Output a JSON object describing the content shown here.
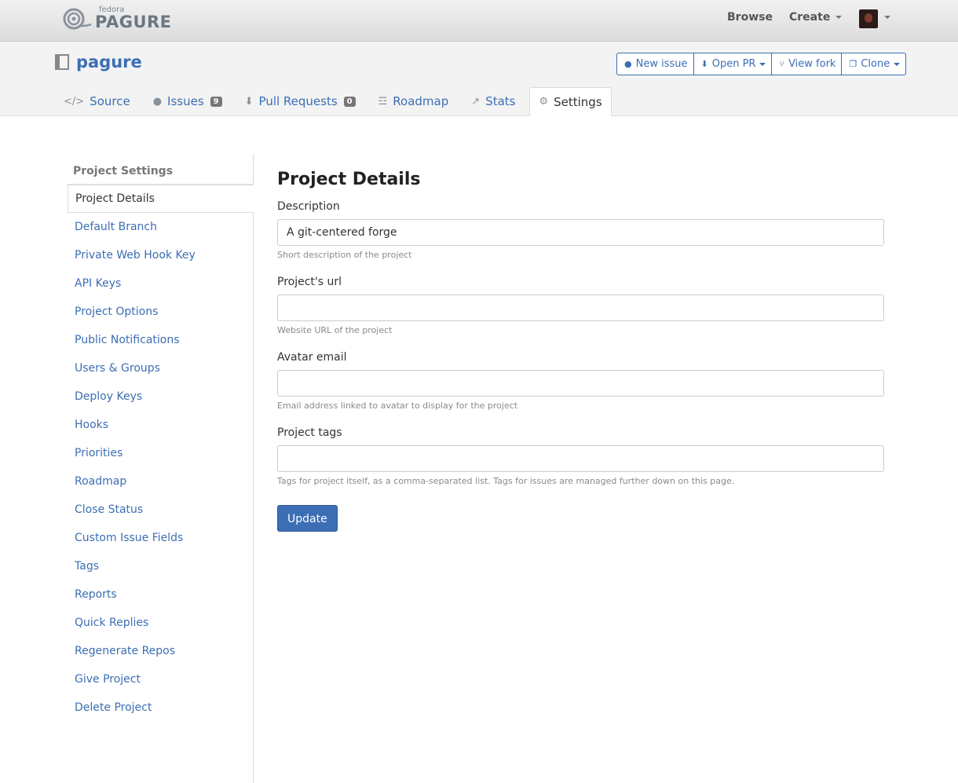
{
  "topnav": {
    "logo_small": "fedora",
    "logo_big": "PAGURE",
    "browse": "Browse",
    "create": "Create"
  },
  "project": {
    "name": "pagure",
    "actions": {
      "new_issue": "New issue",
      "open_pr": "Open PR",
      "view_fork": "View fork",
      "clone": "Clone"
    },
    "tabs": [
      {
        "label": "Source",
        "icon": "code-icon"
      },
      {
        "label": "Issues",
        "icon": "exclamation-icon",
        "badge": "9"
      },
      {
        "label": "Pull Requests",
        "icon": "pull-request-icon",
        "badge": "0"
      },
      {
        "label": "Roadmap",
        "icon": "signpost-icon"
      },
      {
        "label": "Stats",
        "icon": "chart-icon"
      },
      {
        "label": "Settings",
        "icon": "gears-icon"
      }
    ]
  },
  "sidebar": {
    "heading": "Project Settings",
    "items": [
      "Project Details",
      "Default Branch",
      "Private Web Hook Key",
      "API Keys",
      "Project Options",
      "Public Notifications",
      "Users & Groups",
      "Deploy Keys",
      "Hooks",
      "Priorities",
      "Roadmap",
      "Close Status",
      "Custom Issue Fields",
      "Tags",
      "Reports",
      "Quick Replies",
      "Regenerate Repos",
      "Give Project",
      "Delete Project"
    ]
  },
  "form": {
    "title": "Project Details",
    "description": {
      "label": "Description",
      "value": "A git-centered forge",
      "help": "Short description of the project"
    },
    "url": {
      "label": "Project's url",
      "value": "",
      "help": "Website URL of the project"
    },
    "avatar": {
      "label": "Avatar email",
      "value": "",
      "help": "Email address linked to avatar to display for the project"
    },
    "tags": {
      "label": "Project tags",
      "value": "",
      "help": "Tags for project itself, as a comma-separated list. Tags for issues are managed further down on this page."
    },
    "submit": "Update"
  },
  "colors": {
    "link": "#3c6eb4",
    "button": "#3c6eb4"
  }
}
